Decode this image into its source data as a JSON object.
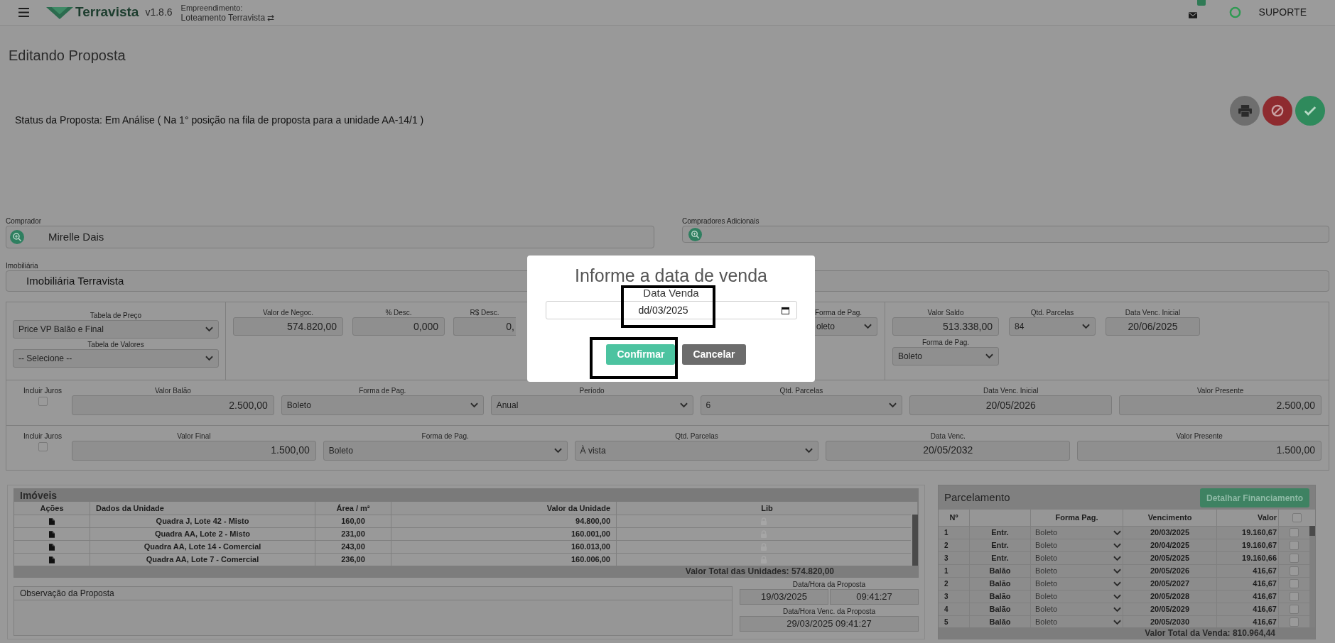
{
  "header": {
    "app_name": "Terravista",
    "version": "v1.8.6",
    "project_label": "Empreendimento:",
    "project_name": "Loteamento Terravista ⇄",
    "support": "SUPORTE"
  },
  "page_title": "Editando Proposta",
  "status": "Status da Proposta: Em Análise ( Na 1° posição na fila de proposta para a unidade AA-14/1 )",
  "buyer": {
    "label": "Comprador",
    "value": "Mirelle Dais"
  },
  "additional_buyers": {
    "label": "Compradores Adicionais"
  },
  "agency": {
    "label": "Imobiliária",
    "value": "Imobiliária Terravista"
  },
  "pricing": {
    "tables": [
      {
        "label": "Tabela de Preço",
        "value": "Price VP Balão e Final"
      },
      {
        "label": "Tabela de Valores",
        "value": "-- Selecione --"
      }
    ],
    "negotiation": [
      {
        "label": "Valor de Negoc.",
        "value": "574.820,00",
        "kind": "number"
      },
      {
        "label": "% Desc.",
        "value": "0,000",
        "kind": "number"
      },
      {
        "label": "R$ Desc.",
        "value": "0,",
        "kind": "partial"
      }
    ],
    "payment": {
      "label": "Forma de Pag.",
      "value": "oleto"
    },
    "balance": [
      {
        "label": "Valor Saldo",
        "value": "513.338,00",
        "kind": "number"
      },
      {
        "label": "Qtd. Parcelas",
        "value": "84",
        "kind": "select"
      },
      {
        "label": "Data Venc. Inicial",
        "value": "20/06/2025",
        "kind": "date"
      }
    ],
    "balance_payment": {
      "label": "Forma de Pag.",
      "value": "Boleto"
    }
  },
  "balloon": {
    "interest_label": "Incluir Juros",
    "interest_checked": false,
    "fields": [
      {
        "label": "Valor Balão",
        "value": "2.500,00",
        "kind": "number"
      },
      {
        "label": "Forma de Pag.",
        "value": "Boleto",
        "kind": "select"
      },
      {
        "label": "Período",
        "value": "Anual",
        "kind": "select"
      },
      {
        "label": "Qtd. Parcelas",
        "value": "6",
        "kind": "select"
      },
      {
        "label": "Data Venc. Inicial",
        "value": "20/05/2026",
        "kind": "date"
      },
      {
        "label": "Valor Presente",
        "value": "2.500,00",
        "kind": "number"
      }
    ]
  },
  "final": {
    "interest_label": "Incluir Juros",
    "interest_checked": false,
    "fields": [
      {
        "label": "Valor Final",
        "value": "1.500,00",
        "kind": "number"
      },
      {
        "label": "Forma de Pag.",
        "value": "Boleto",
        "kind": "select"
      },
      {
        "label": "Qtd. Parcelas",
        "value": "À vista",
        "kind": "select"
      },
      {
        "label": "Data Venc.",
        "value": "20/05/2032",
        "kind": "date"
      },
      {
        "label": "Valor Presente",
        "value": "1.500,00",
        "kind": "number"
      }
    ]
  },
  "units": {
    "title": "Imóveis",
    "columns": [
      "Ações",
      "Dados da Unidade",
      "Área / m²",
      "Valor da Unidade",
      "Lib"
    ],
    "rows": [
      {
        "unit": "Quadra J, Lote 42 - Misto",
        "area": "160,00",
        "value": "94.800,00"
      },
      {
        "unit": "Quadra AA, Lote 2 - Misto",
        "area": "231,00",
        "value": "160.001,00"
      },
      {
        "unit": "Quadra AA, Lote 14 - Comercial",
        "area": "243,00",
        "value": "160.013,00"
      },
      {
        "unit": "Quadra AA, Lote 7 - Comercial",
        "area": "236,00",
        "value": "160.006,00"
      }
    ],
    "total": "Valor Total das Unidades: 574.820,00"
  },
  "notes": {
    "title": "Observação da Proposta"
  },
  "proposal_date": {
    "label": "Data/Hora da Proposta",
    "date": "19/03/2025",
    "time": "09:41:27"
  },
  "expiry": {
    "label": "Data/Hora Venc. da Proposta",
    "value": "29/03/2025 09:41:27"
  },
  "installments": {
    "title": "Parcelamento",
    "button": "Detalhar Financiamento",
    "columns": [
      "Nº",
      "Forma Pag.",
      "Vencimento",
      "Valor"
    ],
    "all_checked": false,
    "rows": [
      {
        "number": "1",
        "type": "Entr.",
        "payment": "Boleto",
        "due": "20/03/2025",
        "value": "19.160,67",
        "checked": false
      },
      {
        "number": "2",
        "type": "Entr.",
        "payment": "Boleto",
        "due": "20/04/2025",
        "value": "19.160,67",
        "checked": false
      },
      {
        "number": "3",
        "type": "Entr.",
        "payment": "Boleto",
        "due": "20/05/2025",
        "value": "19.160,66",
        "checked": false
      },
      {
        "number": "1",
        "type": "Balão",
        "payment": "Boleto",
        "due": "20/05/2026",
        "value": "416,67",
        "checked": false
      },
      {
        "number": "2",
        "type": "Balão",
        "payment": "Boleto",
        "due": "20/05/2027",
        "value": "416,67",
        "checked": false
      },
      {
        "number": "3",
        "type": "Balão",
        "payment": "Boleto",
        "due": "20/05/2028",
        "value": "416,67",
        "checked": false
      },
      {
        "number": "4",
        "type": "Balão",
        "payment": "Boleto",
        "due": "20/05/2029",
        "value": "416,67",
        "checked": false
      },
      {
        "number": "5",
        "type": "Balão",
        "payment": "Boleto",
        "due": "20/05/2030",
        "value": "416,67",
        "checked": false
      }
    ],
    "total": "Valor Total da Venda: 810.964,44"
  },
  "modal": {
    "title": "Informe a data de venda",
    "field_label": "Data Venda",
    "value": "dd/03/2025",
    "buttons": [
      {
        "label": "Confirmar",
        "kind": "primary"
      },
      {
        "label": "Cancelar",
        "kind": "secondary"
      }
    ]
  }
}
